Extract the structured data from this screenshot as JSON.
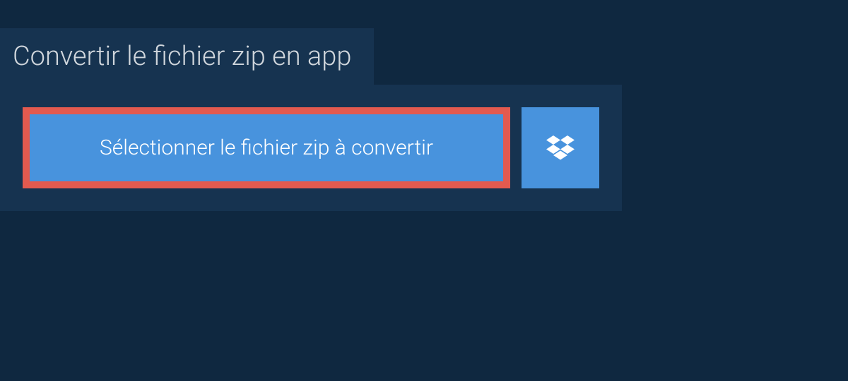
{
  "tab": {
    "label": "Convertir le fichier zip en app"
  },
  "buttons": {
    "select_file_label": "Sélectionner le fichier zip à convertir"
  },
  "colors": {
    "background": "#0f2840",
    "panel": "#163350",
    "button": "#4893dd",
    "highlight_border": "#e35a4f",
    "text_light": "#d0d6dc",
    "text_white": "#ffffff"
  }
}
